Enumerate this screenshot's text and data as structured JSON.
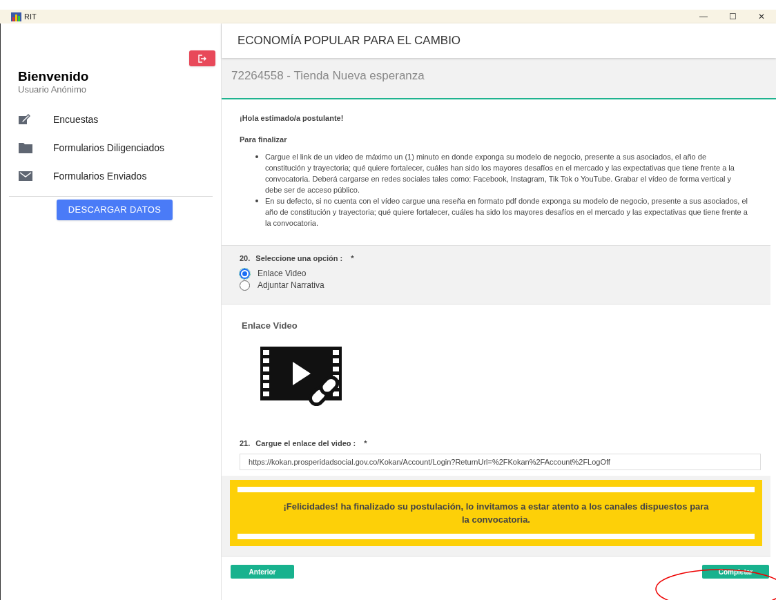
{
  "window": {
    "title": "RIT",
    "controls": [
      "—",
      "☐",
      "✕"
    ]
  },
  "sidebar": {
    "welcome": "Bienvenido",
    "user": "Usuario Anónimo",
    "items": [
      {
        "kind": "edit",
        "label": "Encuestas"
      },
      {
        "kind": "folder",
        "label": "Formularios Diligenciados"
      },
      {
        "kind": "mail",
        "label": "Formularios Enviados"
      }
    ],
    "download_button": "DESCARGAR DATOS"
  },
  "header": {
    "title": "ECONOMÍA POPULAR PARA EL CAMBIO",
    "subtitle": "72264558 - Tienda Nueva esperanza"
  },
  "intro": {
    "greeting": "¡Hola estimado/a postulante!",
    "heading": "Para finalizar",
    "bullets": [
      "Cargue el link de un video de máximo un (1) minuto en donde exponga su modelo de negocio, presente a sus asociados, el año de constitución y trayectoria; qué quiere fortalecer, cuáles han sido los mayores desafíos en el mercado y las expectativas que tiene frente a la convocatoria. Deberá cargarse en redes sociales tales como: Facebook, Instagram, Tik Tok o YouTube. Grabar el vídeo de forma vertical y debe ser de acceso público.",
      "En su defecto, si no cuenta con el vídeo cargue una reseña en formato pdf donde exponga su modelo de negocio, presente a sus asociados, el año de constitución y trayectoria; qué quiere fortalecer, cuáles ha sido los mayores desafíos en el mercado y las expectativas que tiene frente a la convocatoria."
    ]
  },
  "question_20": {
    "number": "20.",
    "label": "Seleccione una opción :",
    "required": "*",
    "options": [
      {
        "label": "Enlace Video",
        "selected": true
      },
      {
        "label": "Adjuntar Narrativa",
        "selected": false
      }
    ]
  },
  "video_section": {
    "title": "Enlace Video"
  },
  "question_21": {
    "number": "21.",
    "label": "Cargue el enlace del video :",
    "required": "*",
    "value": "https://kokan.prosperidadsocial.gov.co/Kokan/Account/Login?ReturnUrl=%2FKokan%2FAccount%2FLogOff"
  },
  "banner": {
    "message": "¡Felicidades! ha finalizado su postulación, lo invitamos a estar atento a los canales dispuestos para la convocatoria."
  },
  "buttons": {
    "previous": "Anterior",
    "complete": "Completar"
  }
}
